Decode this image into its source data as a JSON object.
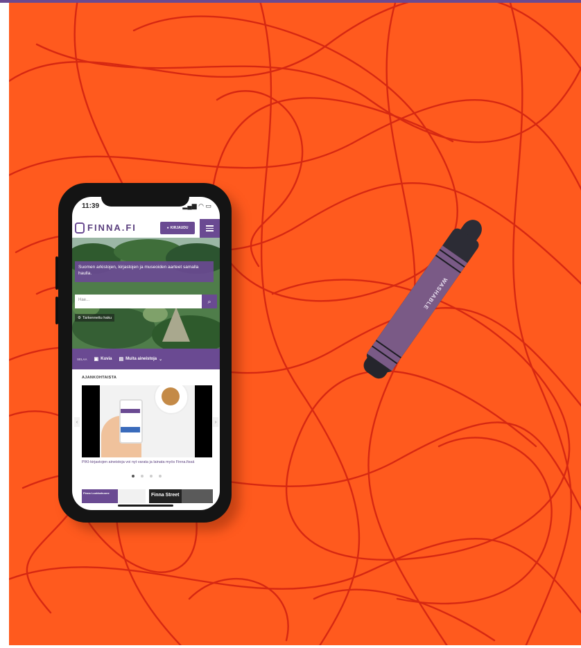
{
  "photo": {
    "background_color": "#ff5a1e",
    "scribble_color": "#d02010",
    "phone": {
      "status_time": "11:39",
      "status_icons": "signal wifi battery",
      "header": {
        "logo": "FINNA.FI",
        "login_label": "KIRJAUDU",
        "menu_icon": "hamburger-icon"
      },
      "hero": {
        "tagline": "Suomen arkistojen, kirjastojen ja museoiden aarteet samalla haulla.",
        "search_placeholder": "Hae...",
        "advanced_search": "Tarkennettu haku"
      },
      "browse": {
        "label": "SELAA",
        "items": [
          {
            "icon": "image-icon",
            "label": "Kuvia"
          },
          {
            "icon": "box-icon",
            "label": "Muita aineistoja"
          }
        ]
      },
      "news": {
        "title": "AJANKOHTAISTA",
        "caption": "PIKI-kirjastojen aineistoja voi nyt varata ja lainata myös Finna.fissä",
        "carousel_dots": 4,
        "active_dot": 1
      },
      "thumbs": [
        {
          "label": "Finna Luokkahuone"
        },
        {
          "label": "Finna Street"
        }
      ]
    },
    "crayon": {
      "label": "WASHABLE",
      "color": "#7a5a86"
    }
  }
}
